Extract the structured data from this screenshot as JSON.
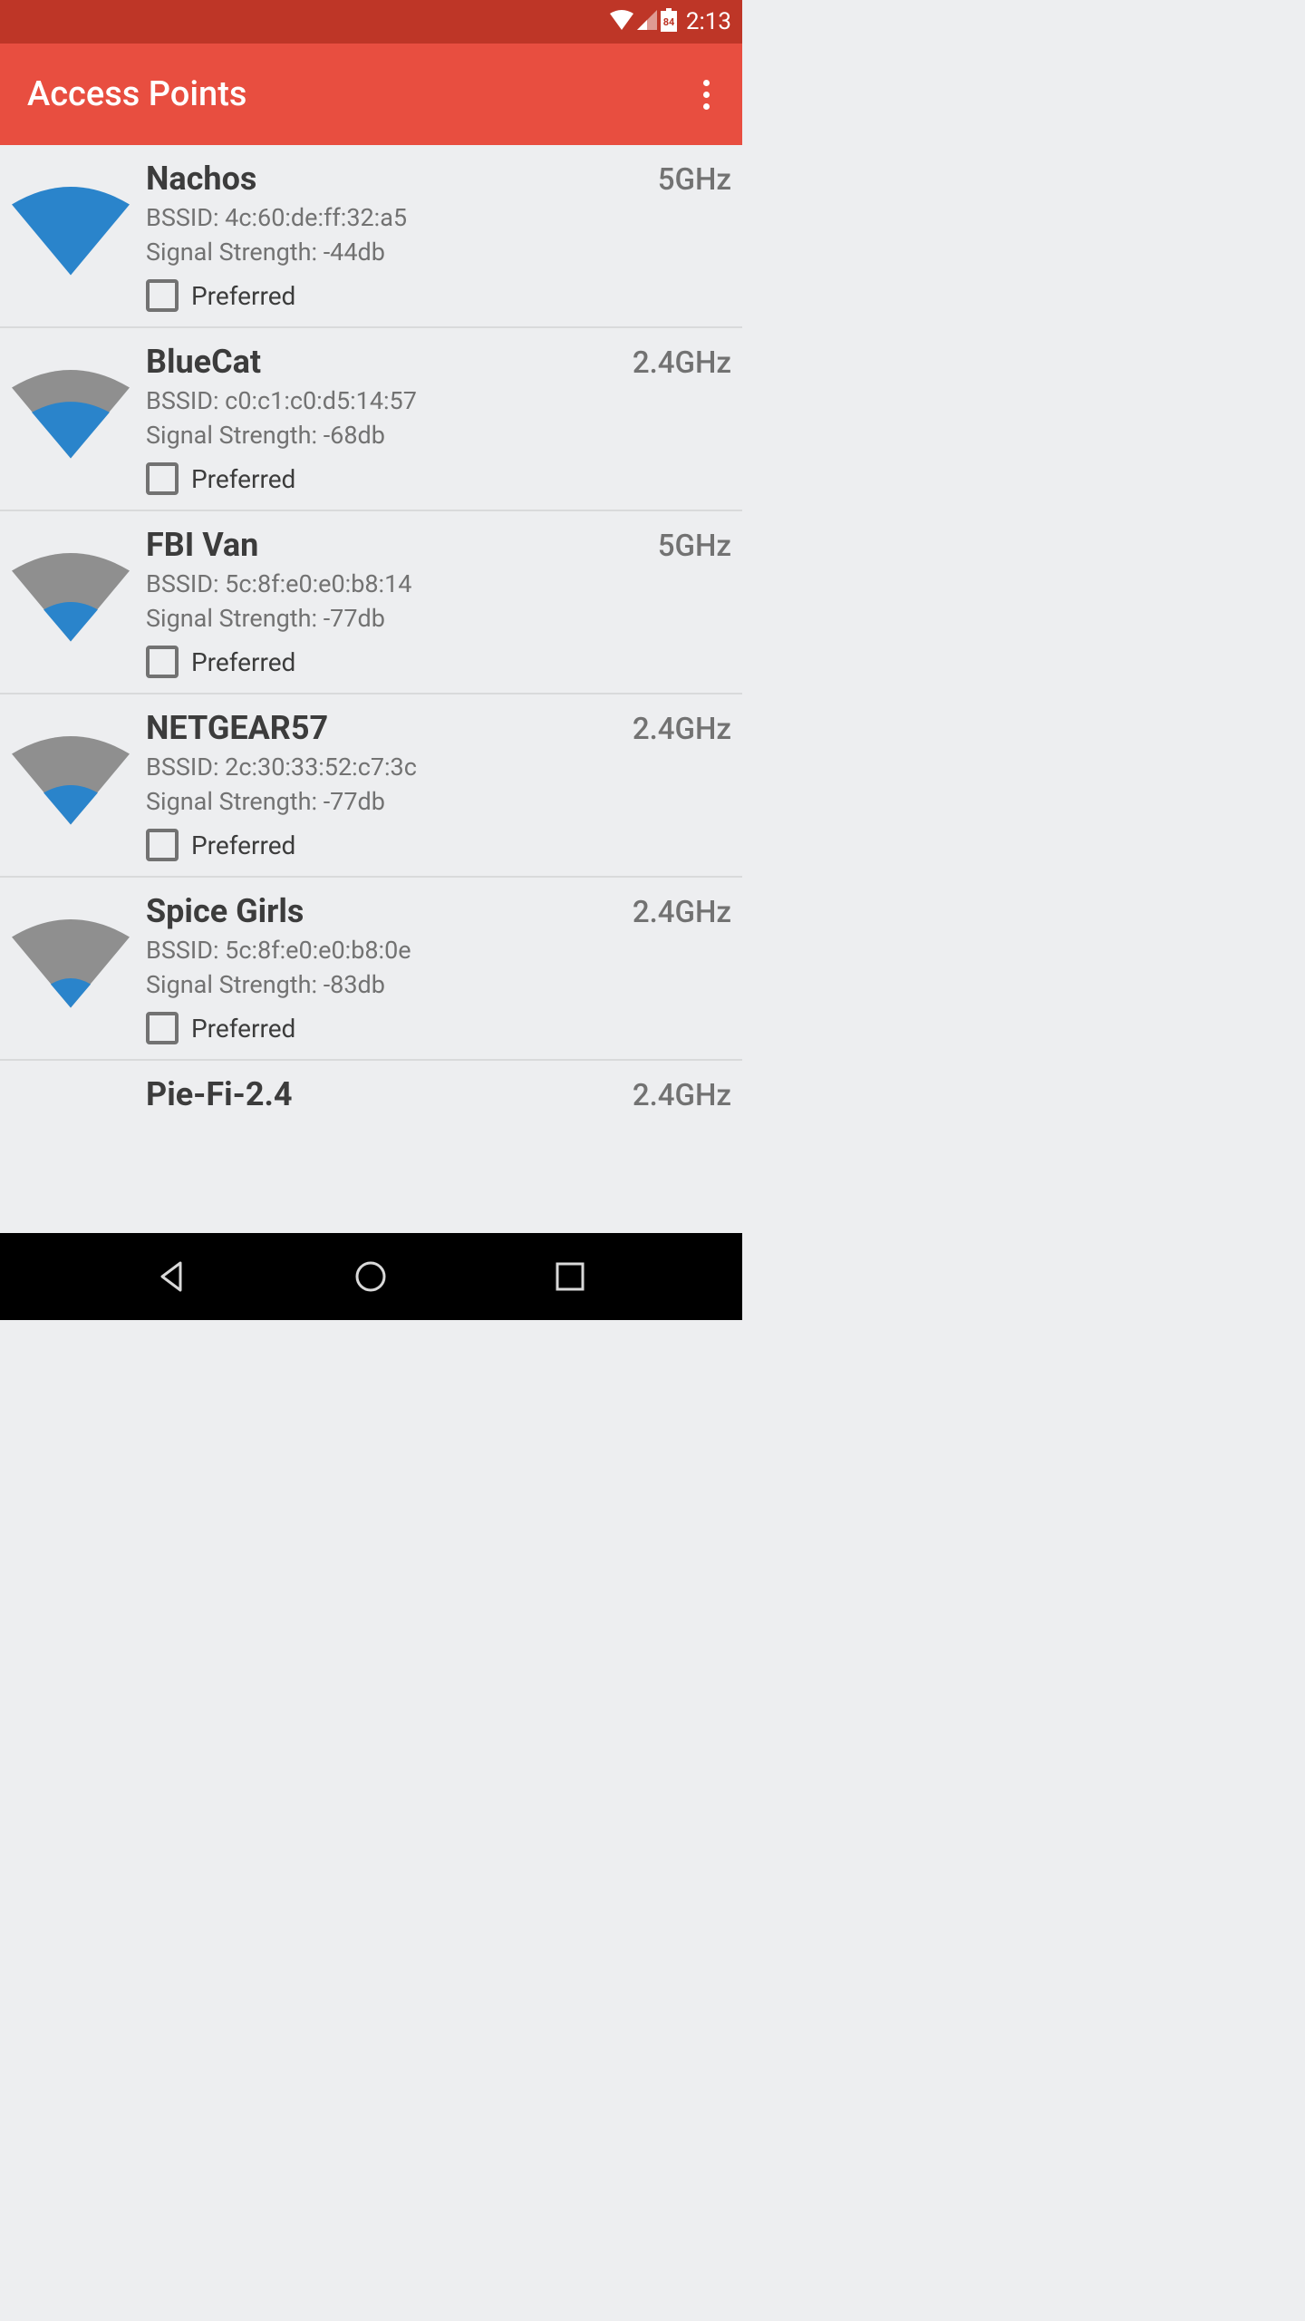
{
  "status_bar": {
    "time": "2:13",
    "battery_level": "84"
  },
  "app_bar": {
    "title": "Access Points"
  },
  "access_points": [
    {
      "name": "Nachos",
      "band": "5GHz",
      "bssid_label": "BSSID: 4c:60:de:ff:32:a5",
      "signal_label": "Signal Strength: -44db",
      "preferred_label": "Preferred",
      "signal_level": 4
    },
    {
      "name": "BlueCat",
      "band": "2.4GHz",
      "bssid_label": "BSSID: c0:c1:c0:d5:14:57",
      "signal_label": "Signal Strength: -68db",
      "preferred_label": "Preferred",
      "signal_level": 2
    },
    {
      "name": "FBI Van",
      "band": "5GHz",
      "bssid_label": "BSSID: 5c:8f:e0:e0:b8:14",
      "signal_label": "Signal Strength: -77db",
      "preferred_label": "Preferred",
      "signal_level": 1
    },
    {
      "name": "NETGEAR57",
      "band": "2.4GHz",
      "bssid_label": "BSSID: 2c:30:33:52:c7:3c",
      "signal_label": "Signal Strength: -77db",
      "preferred_label": "Preferred",
      "signal_level": 1
    },
    {
      "name": "Spice Girls",
      "band": "2.4GHz",
      "bssid_label": "BSSID: 5c:8f:e0:e0:b8:0e",
      "signal_label": "Signal Strength: -83db",
      "preferred_label": "Preferred",
      "signal_level": 1
    },
    {
      "name": "Pie-Fi-2.4",
      "band": "2.4GHz",
      "bssid_label": "",
      "signal_label": "",
      "preferred_label": "",
      "signal_level": 0
    }
  ]
}
